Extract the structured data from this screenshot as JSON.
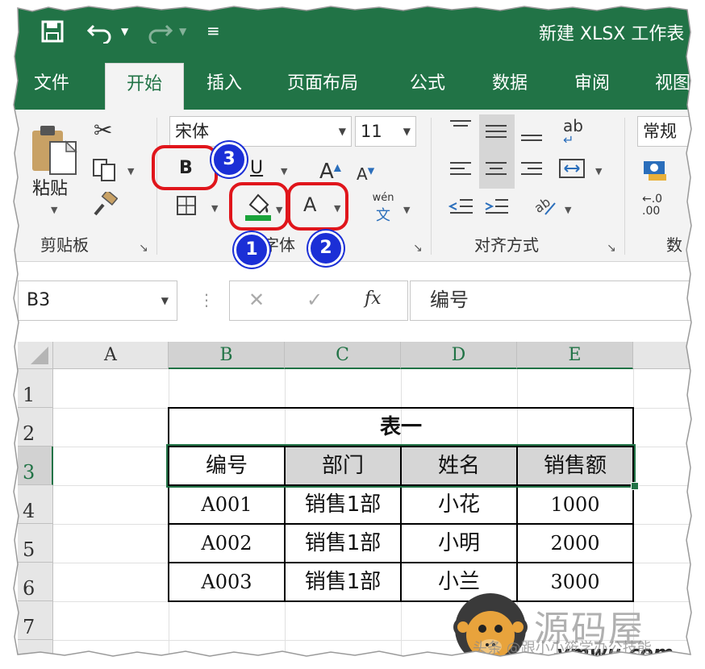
{
  "title_bar": {
    "document_title": "新建 XLSX 工作表",
    "save_icon": "save-icon",
    "undo_icon": "undo-icon",
    "redo_icon": "redo-icon",
    "customize_icon": "customize-quick-access-icon",
    "brand_color": "#217346"
  },
  "tabs": [
    {
      "label": "文件"
    },
    {
      "label": "开始"
    },
    {
      "label": "插入"
    },
    {
      "label": "页面布局"
    },
    {
      "label": "公式"
    },
    {
      "label": "数据"
    },
    {
      "label": "审阅"
    },
    {
      "label": "视图"
    }
  ],
  "ribbon": {
    "clipboard": {
      "paste_label": "粘贴",
      "group_label": "剪贴板"
    },
    "font": {
      "font_name": "宋体",
      "font_size": "11",
      "bold_label": "B",
      "underline_label": "U",
      "increase_font_label": "A",
      "decrease_font_label": "A",
      "font_color_label": "A",
      "phonetic_top": "wén",
      "phonetic_bottom": "文",
      "group_label": "字体"
    },
    "alignment": {
      "wrap_label": "ab",
      "group_label": "对齐方式"
    },
    "number": {
      "format_value": "常规",
      "decimal_increase": "←.0",
      "decimal_decrease": ".00",
      "group_label": "数"
    }
  },
  "annotations": [
    {
      "number": "1",
      "target": "fill-color"
    },
    {
      "number": "2",
      "target": "font-color"
    },
    {
      "number": "3",
      "target": "bold"
    }
  ],
  "formula_bar": {
    "name_box": "B3",
    "cancel": "✕",
    "enter": "✓",
    "fx": "fx",
    "content": "编号"
  },
  "columns": [
    "A",
    "B",
    "C",
    "D",
    "E"
  ],
  "rows": [
    "1",
    "2",
    "3",
    "4",
    "5",
    "6",
    "7"
  ],
  "table": {
    "title": "表一",
    "headers": [
      "编号",
      "部门",
      "姓名",
      "销售额"
    ],
    "rows": [
      [
        "A001",
        "销售1部",
        "小花",
        "1000"
      ],
      [
        "A002",
        "销售1部",
        "小明",
        "2000"
      ],
      [
        "A003",
        "销售1部",
        "小兰",
        "3000"
      ]
    ]
  },
  "watermark": {
    "logo_icon": "monkey-logo-icon",
    "cn_text": "源码屋",
    "url": "ymwu.com",
    "tagline": "头条 @跟小小筱学办公技能"
  }
}
